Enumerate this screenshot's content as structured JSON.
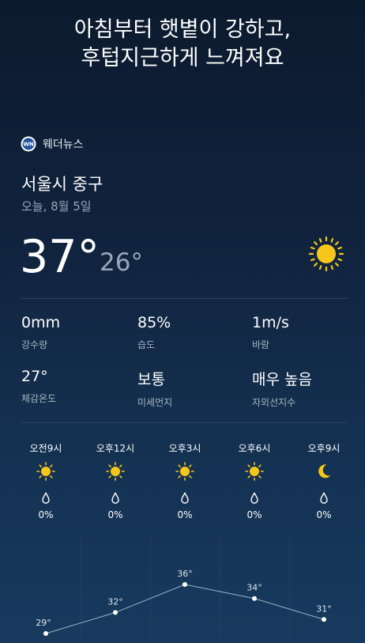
{
  "headline": {
    "line1": "아침부터 햇볕이 강하고,",
    "line2": "후텁지근하게 느껴져요"
  },
  "brand": {
    "name": "웨더뉴스",
    "logo_icon": "weathernews-logo"
  },
  "location": {
    "name": "서울시 중구",
    "date": "오늘, 8월 5일"
  },
  "current": {
    "high": "37°",
    "low": "26°",
    "condition_icon": "sun-icon"
  },
  "stats": [
    {
      "value": "0mm",
      "label": "강수량"
    },
    {
      "value": "85%",
      "label": "습도"
    },
    {
      "value": "1m/s",
      "label": "바람"
    },
    {
      "value": "27°",
      "label": "체감온도"
    },
    {
      "value": "보통",
      "label": "미세먼지"
    },
    {
      "value": "매우 높음",
      "label": "자외선지수"
    }
  ],
  "hourly": [
    {
      "time": "오전9시",
      "icon": "sun-icon",
      "precip": "0%",
      "temp_label": "29°",
      "temp": 29
    },
    {
      "time": "오후12시",
      "icon": "sun-icon",
      "precip": "0%",
      "temp_label": "32°",
      "temp": 32
    },
    {
      "time": "오후3시",
      "icon": "sun-icon",
      "precip": "0%",
      "temp_label": "36°",
      "temp": 36
    },
    {
      "time": "오후6시",
      "icon": "sun-icon",
      "precip": "0%",
      "temp_label": "34°",
      "temp": 34
    },
    {
      "time": "오후9시",
      "icon": "moon-icon",
      "precip": "0%",
      "temp_label": "31°",
      "temp": 31
    }
  ],
  "colors": {
    "sun": "#f7c61a",
    "moon": "#f7c61a",
    "line": "#9fb1c6",
    "secondary_text": "#97a6b8"
  }
}
